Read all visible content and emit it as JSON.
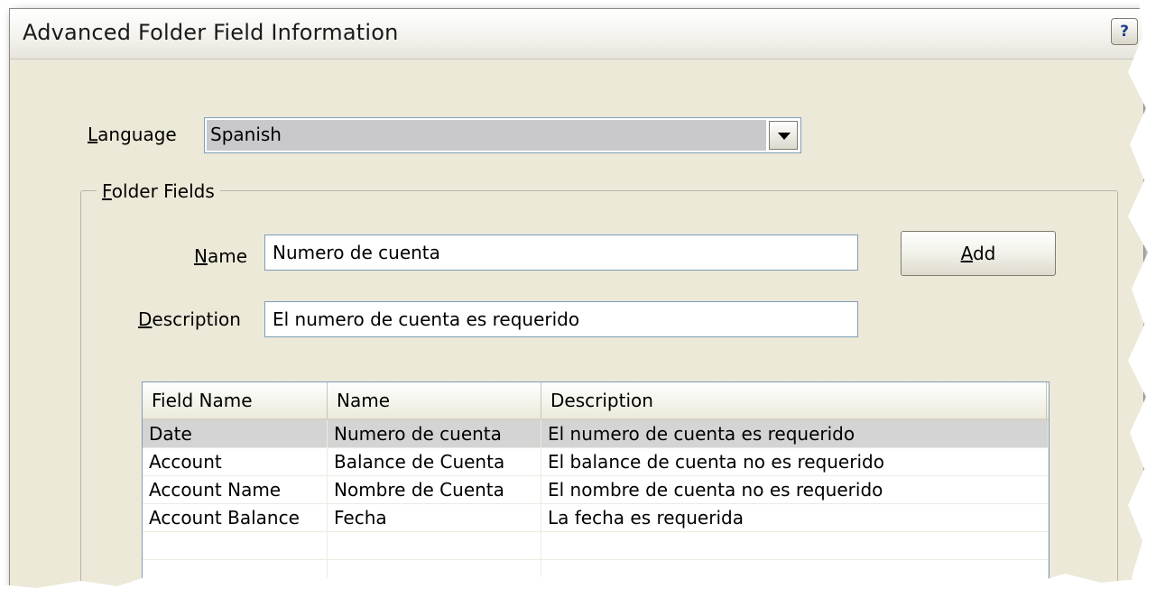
{
  "dialog": {
    "title": "Advanced Folder Field Information",
    "help_label": "?"
  },
  "language": {
    "label": "Language",
    "selected": "Spanish"
  },
  "folder_fields": {
    "legend": "Folder Fields",
    "name_label": "Name",
    "name_value": "Numero de cuenta",
    "description_label": "Description",
    "description_value": "El numero de cuenta es requerido",
    "add_button": "Add"
  },
  "table": {
    "columns": [
      "Field Name",
      "Name",
      "Description"
    ],
    "rows": [
      {
        "field_name": "Date",
        "name": "Numero de cuenta",
        "description": "El numero de cuenta es requerido",
        "selected": true
      },
      {
        "field_name": "Account",
        "name": "Balance de Cuenta",
        "description": "El balance de cuenta no es requerido",
        "selected": false
      },
      {
        "field_name": "Account Name",
        "name": "Nombre de Cuenta",
        "description": "El nombre de cuenta no es requerido",
        "selected": false
      },
      {
        "field_name": "Account Balance",
        "name": "Fecha",
        "description": "La fecha es requerida",
        "selected": false
      },
      {
        "field_name": "",
        "name": "",
        "description": "",
        "selected": false
      },
      {
        "field_name": "",
        "name": "",
        "description": "",
        "selected": false
      }
    ]
  },
  "colors": {
    "dialog_bg": "#ece9d8",
    "selected_row": "#d4d4d4",
    "input_border": "#7f9db9"
  }
}
